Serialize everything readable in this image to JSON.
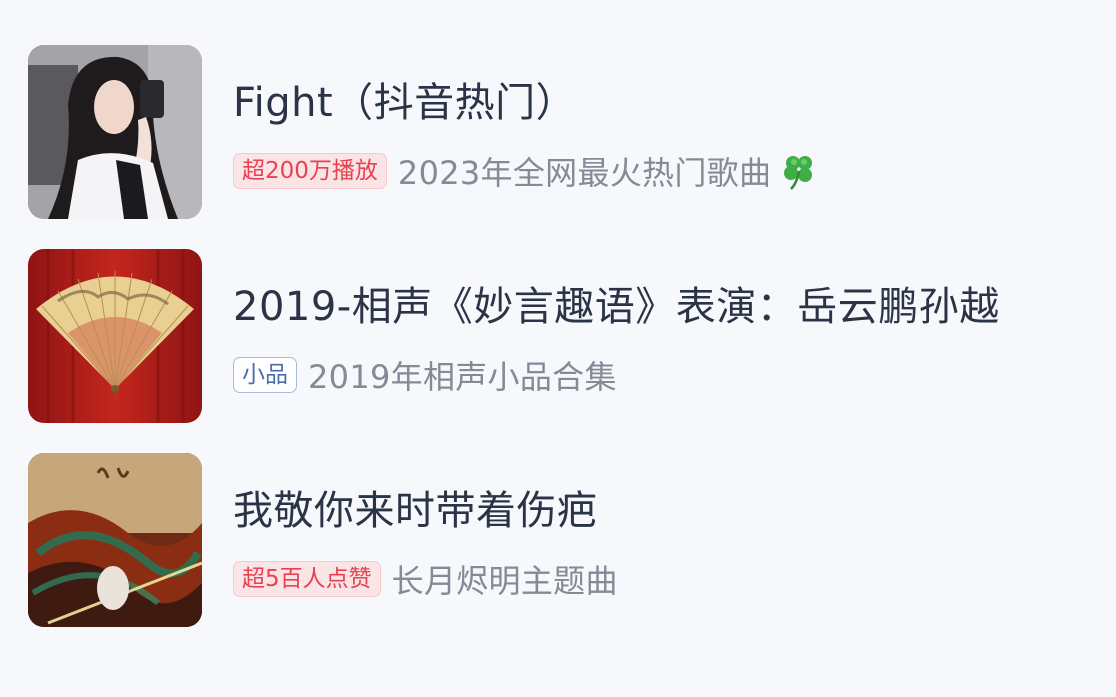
{
  "items": [
    {
      "title": "Fight（抖音热门）",
      "tag": "超200万播放",
      "tag_style": "red",
      "desc": "2023年全网最火热门歌曲",
      "desc_icon": "four-leaf-clover-icon"
    },
    {
      "title": "2019-相声《妙言趣语》表演：岳云鹏孙越",
      "tag": "小品",
      "tag_style": "blue",
      "desc": "2019年相声小品合集"
    },
    {
      "title": "我敬你来时带着伤疤",
      "tag": "超5百人点赞",
      "tag_style": "red",
      "desc": "长月烬明主题曲"
    }
  ],
  "colors": {
    "background": "#f7f8fc",
    "title": "#2b3446",
    "desc": "#858a96",
    "tag_red_text": "#e6424f",
    "tag_red_bg": "#fbe4e6",
    "tag_blue_text": "#4a6ea8",
    "tag_blue_border": "#aab9d9"
  }
}
